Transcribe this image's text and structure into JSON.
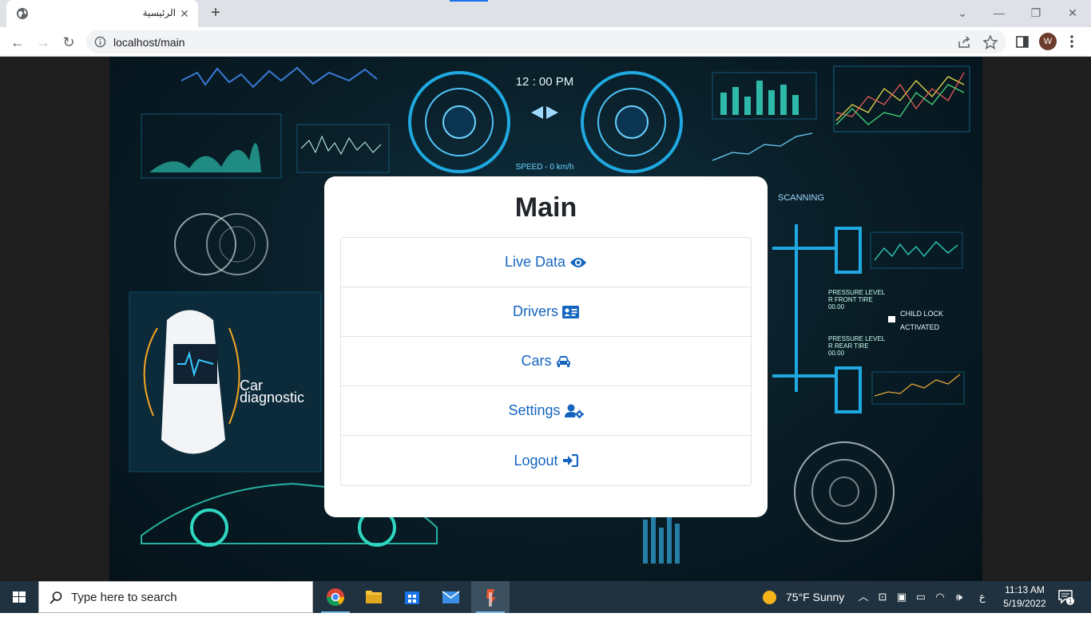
{
  "browser": {
    "tab_title": "الرئيسية",
    "url": "localhost/main",
    "profile_initial": "W"
  },
  "card": {
    "title": "Main",
    "items": [
      {
        "label": "Live Data",
        "icon": "eye-icon"
      },
      {
        "label": "Drivers",
        "icon": "id-card-icon"
      },
      {
        "label": "Cars",
        "icon": "car-icon"
      },
      {
        "label": "Settings",
        "icon": "user-gear-icon"
      },
      {
        "label": "Logout",
        "icon": "sign-in-icon"
      }
    ]
  },
  "hero": {
    "clock": "12 : 00 PM",
    "speed": "SPEED - 0 km/h",
    "scanning": "SCANNING",
    "car_diag_line1": "Car",
    "car_diag_line2": "diagnostic",
    "child_lock_1": "CHILD LOCK",
    "child_lock_2": "ACTIVATED",
    "pressure_front": "PRESSURE LEVEL",
    "front_tire": "R FRONT TIRE",
    "pressure_rear": "PRESSURE LEVEL",
    "rear_tire": "R REAR TIRE",
    "pressure_value": "00.00"
  },
  "taskbar": {
    "search_placeholder": "Type here to search",
    "weather": "75°F  Sunny",
    "lang": "ع",
    "time": "11:13 AM",
    "date": "5/19/2022",
    "notifications": "1"
  },
  "colors": {
    "link": "#1565c0",
    "hud": "#1fa9e0",
    "taskbar": "#20323f"
  }
}
